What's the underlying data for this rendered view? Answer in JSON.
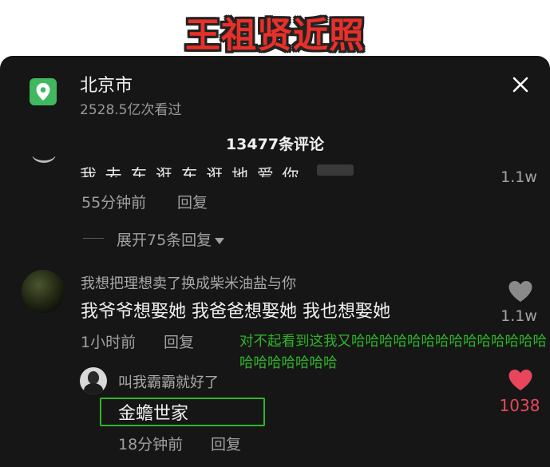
{
  "banner": {
    "title": "王祖贤近照"
  },
  "location": {
    "name": "北京市",
    "views": "2528.5亿次看过"
  },
  "header": {
    "comment_count": "13477条评论"
  },
  "comments": [
    {
      "text": "我.去.东.逛.东.逛.地.爱.你.",
      "likes": "1.1w",
      "time": "55分钟前",
      "reply_label": "回复",
      "expand_label": "展开75条回复"
    },
    {
      "username": "我想把理想卖了换成柴米油盐与你",
      "text": "我爷爷想娶她 我爸爸想娶她 我也想娶她",
      "likes": "1.1w",
      "time": "1小时前",
      "reply_label": "回复",
      "replies": [
        {
          "username": "叫我霸霸就好了",
          "text": "金蟾世家",
          "likes": "1038",
          "liked": true,
          "time": "18分钟前",
          "reply_label": "回复"
        }
      ]
    }
  ],
  "overlay_caption": "对不起看到这我又哈哈哈哈哈哈哈哈哈哈哈哈哈哈哈哈哈哈哈哈哈",
  "colors": {
    "panel_bg": "#161616",
    "location_icon": "#3fb85f",
    "annotation_green": "#2fb52a",
    "liked_red": "#e8475b",
    "banner_red": "#e8302a"
  },
  "icons": {
    "location": "location-pin-icon",
    "close": "close-icon",
    "like": "heart-icon",
    "expand": "caret-down-icon"
  }
}
